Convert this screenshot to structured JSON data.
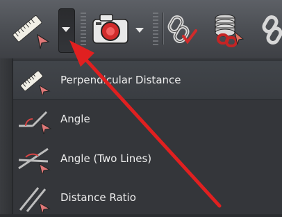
{
  "toolbar": {
    "buttons": [
      {
        "name": "measure-ruler",
        "icon": "ruler-cursor-icon"
      },
      {
        "name": "measure-dropdown",
        "icon": "chevron-down-icon"
      },
      {
        "name": "camera",
        "icon": "camera-icon"
      },
      {
        "name": "camera-dropdown",
        "icon": "chevron-down-icon"
      },
      {
        "name": "link-check",
        "icon": "chain-check-icon"
      },
      {
        "name": "stack-link",
        "icon": "stack-chain-icon"
      },
      {
        "name": "link-partial",
        "icon": "chain-icon"
      }
    ]
  },
  "menu": {
    "items": [
      {
        "label": "Perpendicular Distance",
        "icon": "ruler-cursor-icon",
        "highlighted": true
      },
      {
        "label": "Angle",
        "icon": "angle-icon",
        "highlighted": false
      },
      {
        "label": "Angle (Two Lines)",
        "icon": "angle-two-lines-icon",
        "highlighted": false
      },
      {
        "label": "Distance Ratio",
        "icon": "distance-ratio-icon",
        "highlighted": false
      }
    ]
  },
  "annotation": {
    "color": "#e02020",
    "icon": "red-arrow"
  },
  "colors": {
    "accent_red": "#e02020",
    "menu_bg": "#34363a",
    "toolbar_bg": "#4a4d52",
    "text": "#ededed"
  }
}
